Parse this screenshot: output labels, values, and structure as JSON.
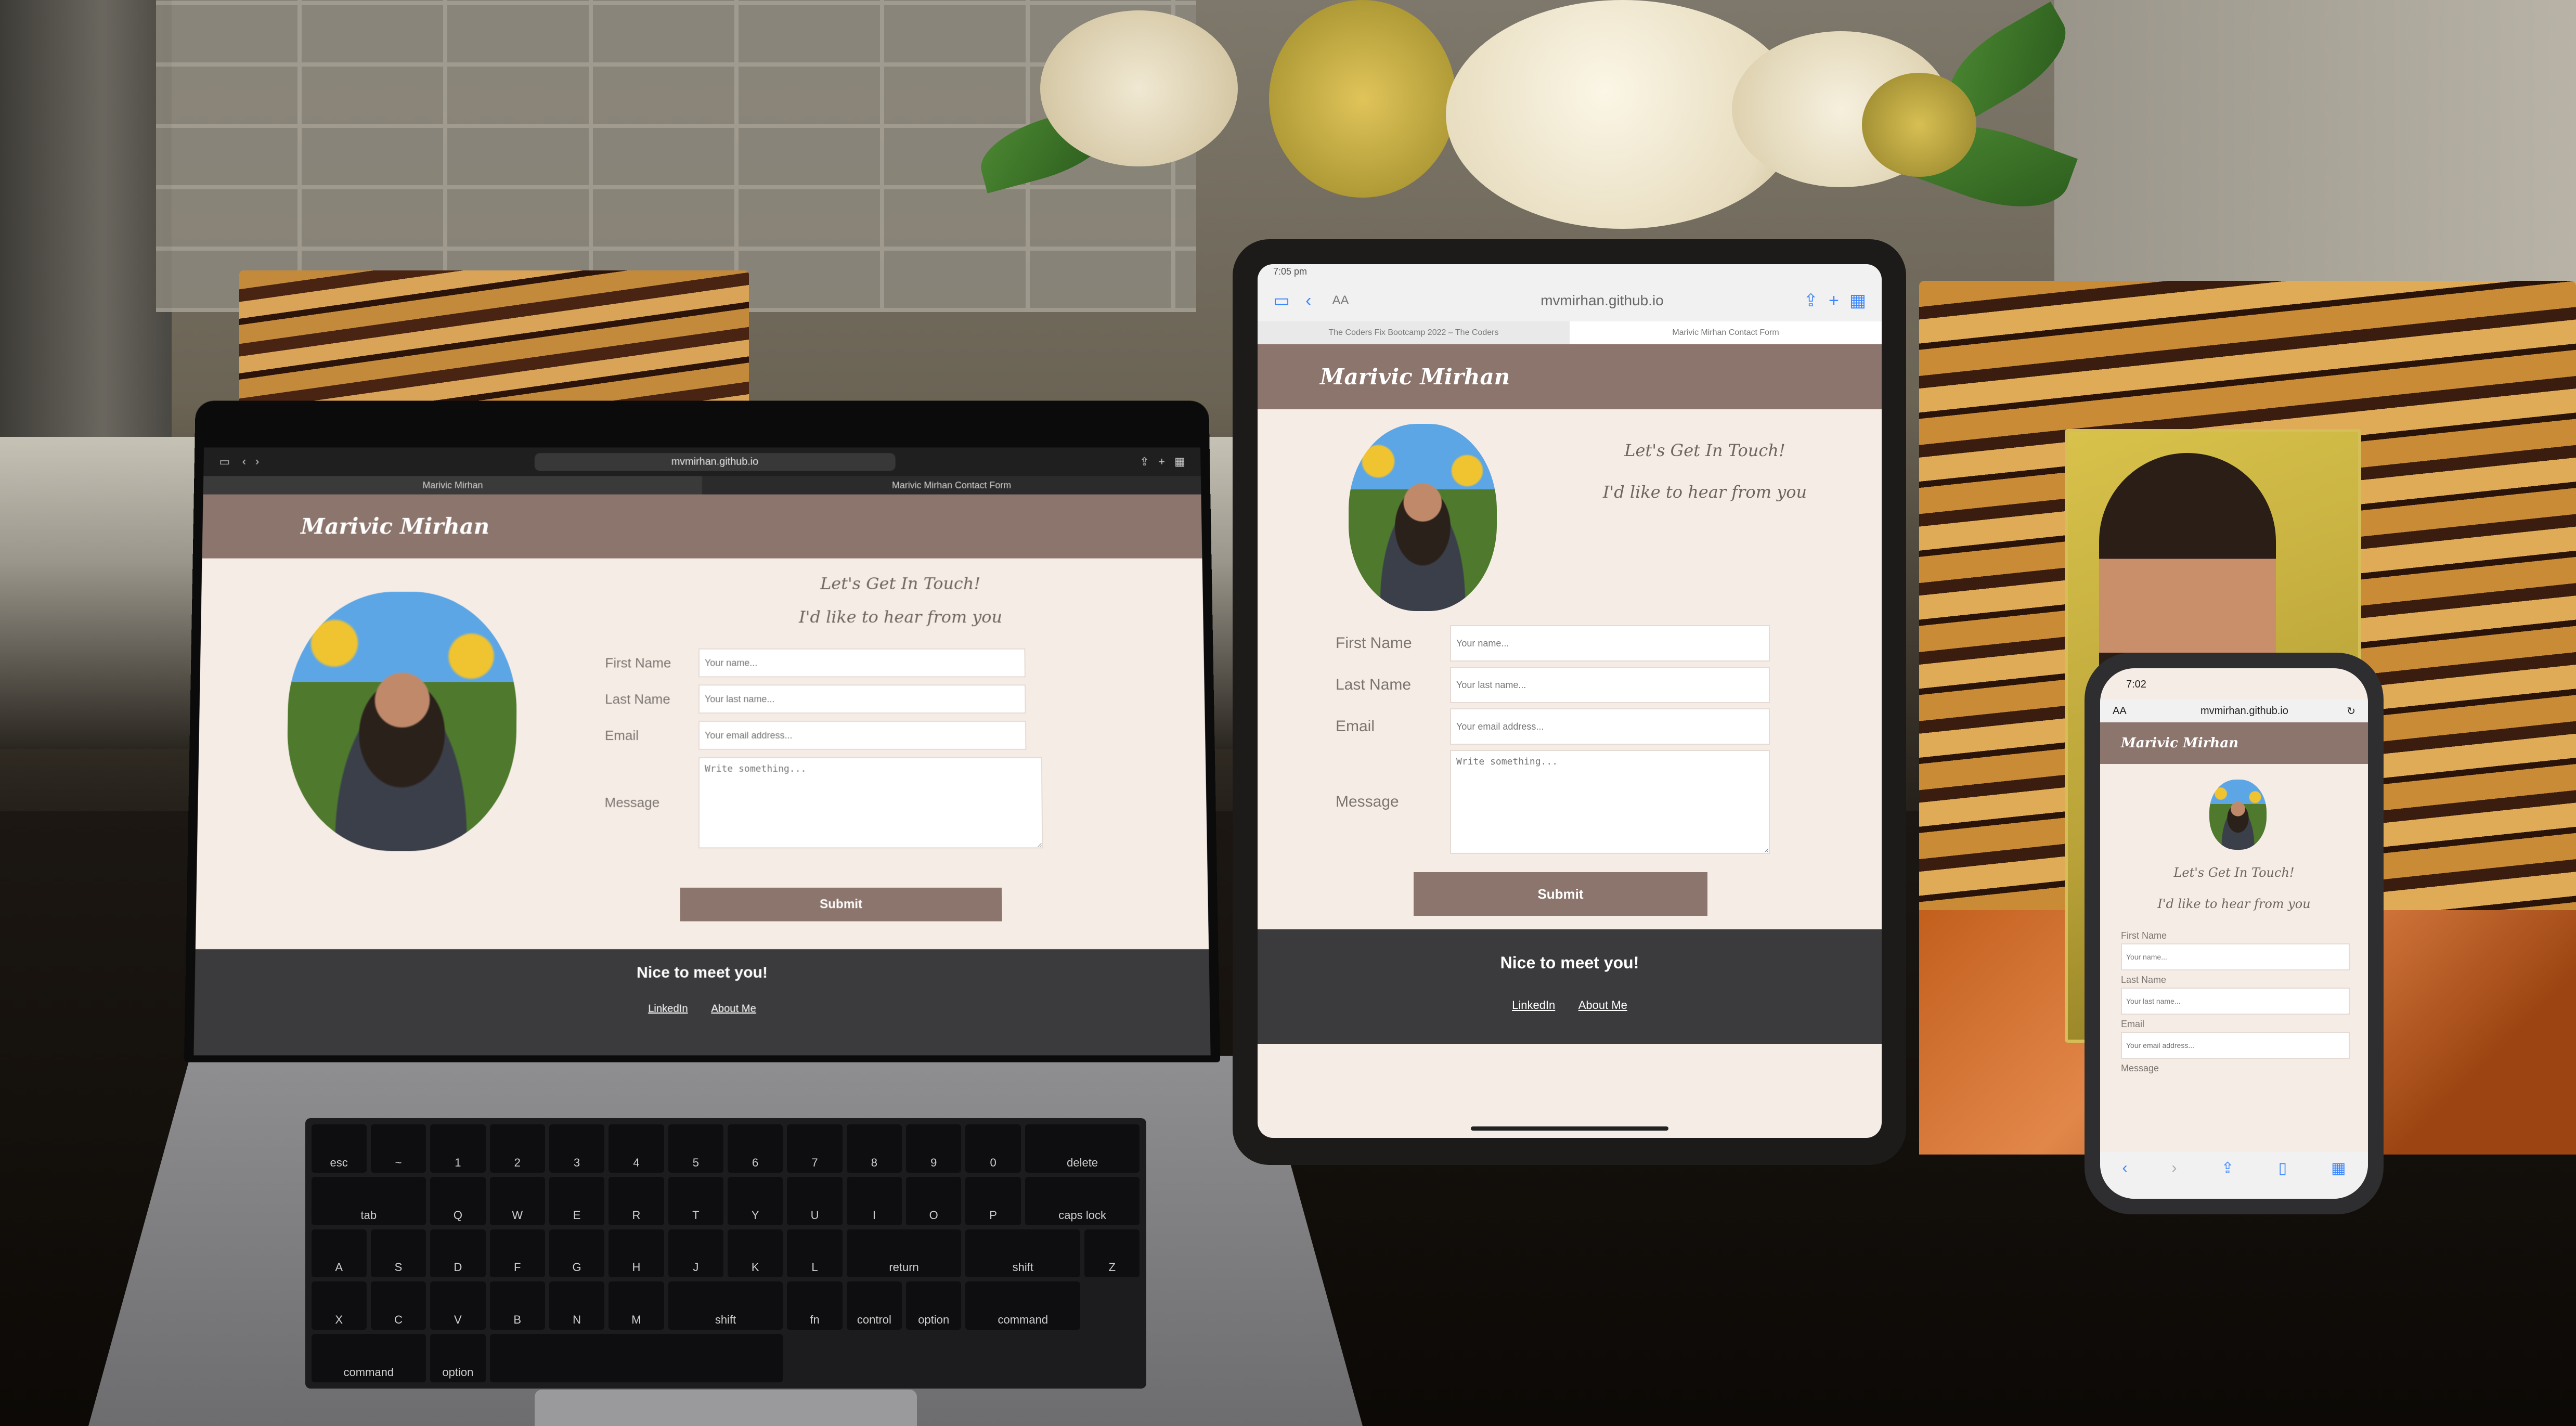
{
  "site": {
    "brand": "Marivic Mirhan",
    "heading_1": "Let's Get In Touch!",
    "heading_2": "I'd like to hear from you",
    "fields": {
      "first_name": {
        "label": "First Name",
        "placeholder": "Your name..."
      },
      "last_name": {
        "label": "Last Name",
        "placeholder": "Your last name..."
      },
      "email": {
        "label": "Email",
        "placeholder": "Your email address..."
      },
      "message": {
        "label": "Message",
        "placeholder": "Write something..."
      }
    },
    "submit_label": "Submit",
    "footer": {
      "tagline": "Nice to meet you!",
      "links": [
        "LinkedIn",
        "About Me"
      ]
    }
  },
  "laptop": {
    "url": "mvmirhan.github.io",
    "tabs": [
      "Marivic Mirhan",
      "Marivic Mirhan Contact Form"
    ],
    "keys": [
      "esc",
      "~",
      "1",
      "2",
      "3",
      "4",
      "5",
      "6",
      "7",
      "8",
      "9",
      "0",
      "delete",
      "tab",
      "Q",
      "W",
      "E",
      "R",
      "T",
      "Y",
      "U",
      "I",
      "O",
      "P",
      "caps lock",
      "A",
      "S",
      "D",
      "F",
      "G",
      "H",
      "J",
      "K",
      "L",
      "return",
      "shift",
      "Z",
      "X",
      "C",
      "V",
      "B",
      "N",
      "M",
      "shift",
      "fn",
      "control",
      "option",
      "command",
      "command",
      "option"
    ]
  },
  "tablet": {
    "status_time": "7:05 pm",
    "url": "mvmirhan.github.io",
    "text_size": "AA",
    "tabs": [
      "The Coders Fix Bootcamp 2022 – The Coders",
      "Marivic Mirhan Contact Form"
    ]
  },
  "phone": {
    "status_time": "7:02",
    "url": "mvmirhan.github.io",
    "text_size": "AA"
  },
  "colors": {
    "header": "#8b756d",
    "page_bg": "#f6ece6",
    "footer": "#3b3b3d"
  }
}
